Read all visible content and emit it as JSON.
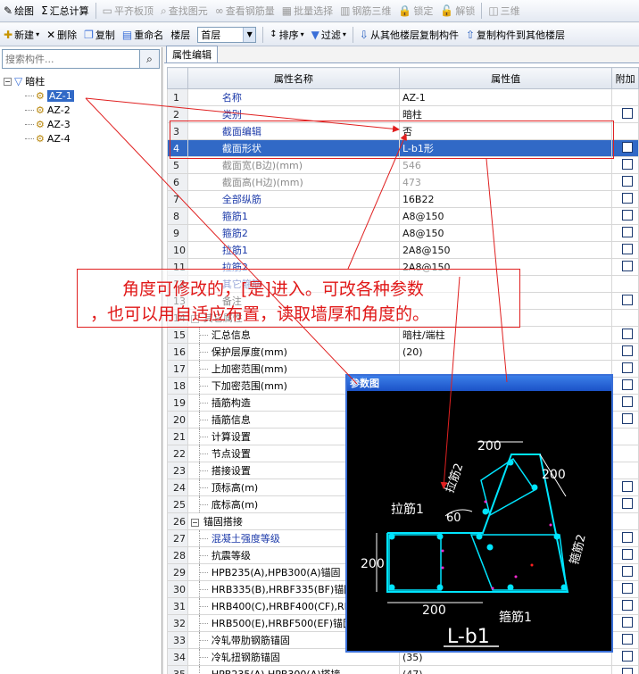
{
  "toolbar1": [
    {
      "name": "draw-button",
      "icon": "✎",
      "label": "绘图",
      "enabled": true
    },
    {
      "name": "summary-calc-button",
      "icon": "Σ",
      "label": "汇总计算",
      "enabled": true
    },
    {
      "name": "align-slab-button",
      "icon": "▭",
      "label": "平齐板顶",
      "enabled": false
    },
    {
      "name": "find-element-button",
      "icon": "⌕",
      "label": "查找图元",
      "enabled": false
    },
    {
      "name": "view-rebar-button",
      "icon": "∞",
      "label": "查看钢筋量",
      "enabled": false
    },
    {
      "name": "batch-select-button",
      "icon": "▦",
      "label": "批量选择",
      "enabled": false
    },
    {
      "name": "rebar-3d-button",
      "icon": "▥",
      "label": "钢筋三维",
      "enabled": false
    },
    {
      "name": "lock-button",
      "icon": "🔒",
      "label": "锁定",
      "enabled": false
    },
    {
      "name": "unlock-button",
      "icon": "🔓",
      "label": "解锁",
      "enabled": false
    },
    {
      "name": "3d-button",
      "icon": "◫",
      "label": "三维",
      "enabled": false
    }
  ],
  "toolbar2": {
    "new_label": "新建",
    "delete_label": "删除",
    "copy_label": "复制",
    "rename_label": "重命名",
    "floor_label": "楼层",
    "floor_value": "首层",
    "sort_label": "排序",
    "filter_label": "过滤",
    "copy_from_label": "从其他楼层复制构件",
    "copy_to_label": "复制构件到其他楼层"
  },
  "left": {
    "search_placeholder": "搜索构件...",
    "root_label": "暗柱",
    "items": [
      "AZ-1",
      "AZ-2",
      "AZ-3",
      "AZ-4"
    ]
  },
  "tab_label": "属性编辑",
  "grid": {
    "headers": [
      "属性名称",
      "属性值",
      "附加"
    ],
    "rows": [
      {
        "no": "1",
        "name": "名称",
        "value": "AZ-1",
        "style": "blue top",
        "cb": false
      },
      {
        "no": "2",
        "name": "类别",
        "value": "暗柱",
        "style": "blue top",
        "cb": true
      },
      {
        "no": "3",
        "name": "截面编辑",
        "value": "否",
        "style": "blue top",
        "cb": false
      },
      {
        "no": "4",
        "name": "截面形状",
        "value": "L-b1形",
        "style": "top",
        "cb": true,
        "selected": true
      },
      {
        "no": "5",
        "name": "截面宽(B边)(mm)",
        "value": "546",
        "style": "gray top",
        "cb": true,
        "gray_value": true
      },
      {
        "no": "6",
        "name": "截面高(H边)(mm)",
        "value": "473",
        "style": "gray top",
        "cb": true,
        "gray_value": true
      },
      {
        "no": "7",
        "name": "全部纵筋",
        "value": "16B22",
        "style": "blue top",
        "cb": true
      },
      {
        "no": "8",
        "name": "箍筋1",
        "value": "A8@150",
        "style": "blue top",
        "cb": true
      },
      {
        "no": "9",
        "name": "箍筋2",
        "value": "A8@150",
        "style": "blue top",
        "cb": true
      },
      {
        "no": "10",
        "name": "拉筋1",
        "value": "2A8@150",
        "style": "blue top",
        "cb": true
      },
      {
        "no": "11",
        "name": "拉筋2",
        "value": "2A8@150",
        "style": "blue top",
        "cb": true
      },
      {
        "no": "12",
        "name": "其它箍筋",
        "value": "",
        "style": "blue top",
        "cb": false
      },
      {
        "no": "13",
        "name": "备注",
        "value": "",
        "style": "top",
        "cb": true
      },
      {
        "no": "14",
        "name": "其它属性",
        "value": "",
        "style": "group",
        "cb": false
      },
      {
        "no": "15",
        "name": "汇总信息",
        "value": "暗柱/端柱",
        "style": "sub",
        "cb": true
      },
      {
        "no": "16",
        "name": "保护层厚度(mm)",
        "value": "(20)",
        "style": "sub",
        "cb": true
      },
      {
        "no": "17",
        "name": "上加密范围(mm)",
        "value": "",
        "style": "sub",
        "cb": true
      },
      {
        "no": "18",
        "name": "下加密范围(mm)",
        "value": "",
        "style": "sub",
        "cb": true
      },
      {
        "no": "19",
        "name": "插筋构造",
        "value": "",
        "style": "sub",
        "cb": true
      },
      {
        "no": "20",
        "name": "插筋信息",
        "value": "",
        "style": "sub",
        "cb": true
      },
      {
        "no": "21",
        "name": "计算设置",
        "value": "",
        "style": "sub",
        "cb": false
      },
      {
        "no": "22",
        "name": "节点设置",
        "value": "",
        "style": "sub",
        "cb": false
      },
      {
        "no": "23",
        "name": "搭接设置",
        "value": "",
        "style": "sub",
        "cb": false
      },
      {
        "no": "24",
        "name": "顶标高(m)",
        "value": "",
        "style": "sub",
        "cb": true
      },
      {
        "no": "25",
        "name": "底标高(m)",
        "value": "",
        "style": "sub",
        "cb": true
      },
      {
        "no": "26",
        "name": "锚固搭接",
        "value": "",
        "style": "group",
        "cb": false
      },
      {
        "no": "27",
        "name": "混凝土强度等级",
        "value": "",
        "style": "sub blue",
        "cb": true
      },
      {
        "no": "28",
        "name": "抗震等级",
        "value": "",
        "style": "sub",
        "cb": true
      },
      {
        "no": "29",
        "name": "HPB235(A),HPB300(A)锚固",
        "value": "",
        "style": "sub",
        "cb": true
      },
      {
        "no": "30",
        "name": "HRB335(B),HRBF335(BF)锚固",
        "value": "",
        "style": "sub",
        "cb": true
      },
      {
        "no": "31",
        "name": "HRB400(C),HRBF400(CF),RRB",
        "value": "",
        "style": "sub",
        "cb": true
      },
      {
        "no": "32",
        "name": "HRB500(E),HRBF500(EF)锚固",
        "value": "",
        "style": "sub",
        "cb": true
      },
      {
        "no": "33",
        "name": "冷轧带肋钢筋锚固",
        "value": "",
        "style": "sub",
        "cb": true
      },
      {
        "no": "34",
        "name": "冷轧扭钢筋锚固",
        "value": "(35)",
        "style": "sub",
        "cb": true
      },
      {
        "no": "35",
        "name": "HPB235(A),HPB300(A)搭接",
        "value": "(47)",
        "style": "sub",
        "cb": true
      }
    ]
  },
  "annotation": {
    "line1": "角度可修改的，[是]进入。可改各种参数",
    "line2": "，也可以用自适应布置，读取墙厚和角度的。"
  },
  "param_panel": {
    "title": "参数图",
    "dim_top": "200",
    "dim_right": "200",
    "dim_left": "200",
    "dim_bottom": "200",
    "angle": "60",
    "label_tie1": "拉筋1",
    "label_tie2": "拉筋2",
    "label_stirrup1": "箍筋1",
    "label_stirrup2": "箍筋2",
    "shape_name": "L-b1",
    "colors": {
      "outline": "#00e5ff",
      "text": "#ffffff",
      "dim": "#ffffff",
      "bar": "#00e5ff",
      "mark": "#ff2ad4",
      "center": "#ff2020"
    }
  }
}
